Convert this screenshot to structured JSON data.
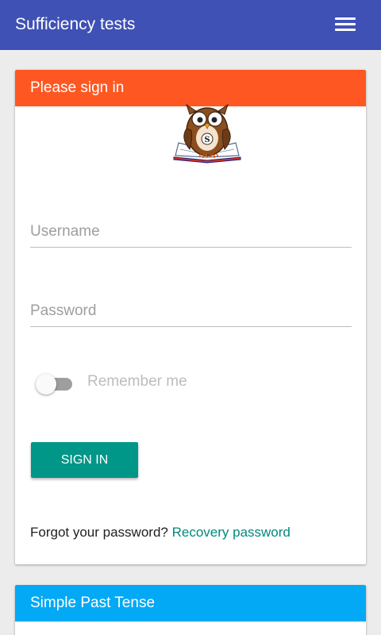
{
  "appbar": {
    "title": "Sufficiency tests",
    "menu_icon": "hamburger-menu-icon",
    "color": "#3f51b5"
  },
  "signin": {
    "header": "Please sign in",
    "header_color": "#ff5722",
    "logo": "owl-book-logo",
    "username_placeholder": "Username",
    "password_placeholder": "Password",
    "remember_label": "Remember me",
    "remember_checked": false,
    "button_label": "SIGN IN",
    "button_color": "#009688",
    "forgot_text": "Forgot your password?",
    "recovery_link": "Recovery password",
    "link_color": "#00897b"
  },
  "past_tense_card": {
    "header": "Simple Past Tense",
    "header_color": "#03a9f4"
  }
}
